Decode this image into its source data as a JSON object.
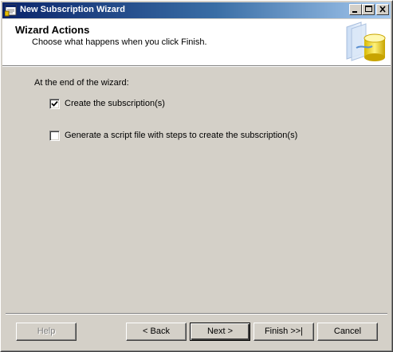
{
  "window": {
    "title": "New Subscription Wizard",
    "controls": [
      "minimize-icon",
      "maximize-icon",
      "close-icon"
    ]
  },
  "header": {
    "title": "Wizard Actions",
    "subtitle": "Choose what happens when you click Finish.",
    "graphic": "database-wizard-icon"
  },
  "body": {
    "prompt": "At the end of the wizard:",
    "options": [
      {
        "label": "Create the subscription(s)",
        "checked": true
      },
      {
        "label": "Generate a script file with steps to create the subscription(s)",
        "checked": false
      }
    ]
  },
  "footer": {
    "help": "Help",
    "back": "< Back",
    "next": "Next >",
    "finish": "Finish >>|",
    "cancel": "Cancel"
  },
  "colors": {
    "titlebar_start": "#0a246a",
    "titlebar_end": "#a6caf0",
    "face": "#d4d0c8",
    "header_bg": "#ffffff"
  }
}
